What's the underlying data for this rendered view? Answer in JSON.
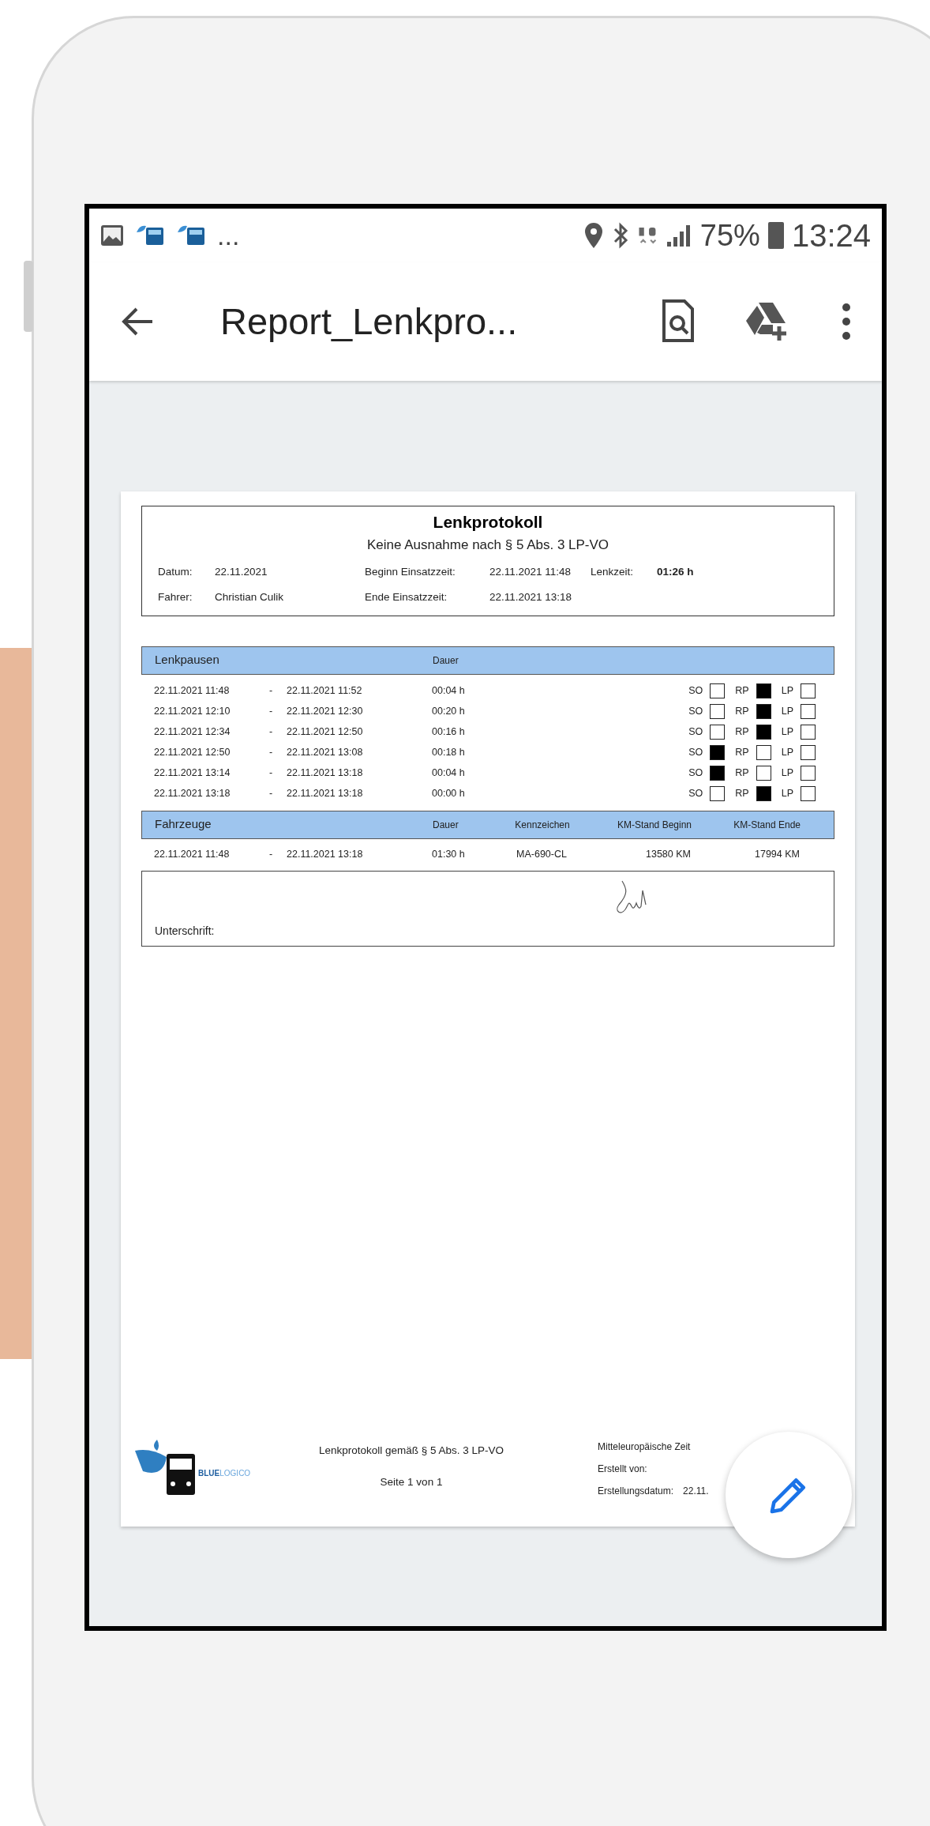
{
  "status_bar": {
    "more": "...",
    "battery": "75%",
    "time": "13:24"
  },
  "app_bar": {
    "title": "Report_Lenkpro..."
  },
  "document": {
    "title": "Lenkprotokoll",
    "subtitle": "Keine Ausnahme nach § 5 Abs. 3 LP-VO",
    "info": [
      {
        "label": "Datum:",
        "value": "22.11.2021"
      },
      {
        "label": "Beginn Einsatzzeit:",
        "value": "22.11.2021 11:48"
      },
      {
        "label": "Lenkzeit:",
        "value": "01:26 h"
      },
      {
        "label": "Fahrer:",
        "value": "Christian Culik"
      },
      {
        "label": "Ende Einsatzzeit:",
        "value": "22.11.2021 13:18"
      }
    ],
    "breaks": {
      "title": "Lenkpausen",
      "duration_heading": "Dauer",
      "rows": [
        {
          "start": "22.11.2021 11:48",
          "dash": "-",
          "end": "22.11.2021 11:52",
          "duration": "00:04 h",
          "flags": [
            {
              "label": "SO",
              "checked": false
            },
            {
              "label": "RP",
              "checked": true
            },
            {
              "label": "LP",
              "checked": false
            }
          ]
        },
        {
          "start": "22.11.2021 12:10",
          "dash": "-",
          "end": "22.11.2021 12:30",
          "duration": "00:20 h",
          "flags": [
            {
              "label": "SO",
              "checked": false
            },
            {
              "label": "RP",
              "checked": true
            },
            {
              "label": "LP",
              "checked": false
            }
          ]
        },
        {
          "start": "22.11.2021 12:34",
          "dash": "-",
          "end": "22.11.2021 12:50",
          "duration": "00:16 h",
          "flags": [
            {
              "label": "SO",
              "checked": false
            },
            {
              "label": "RP",
              "checked": true
            },
            {
              "label": "LP",
              "checked": false
            }
          ]
        },
        {
          "start": "22.11.2021 12:50",
          "dash": "-",
          "end": "22.11.2021 13:08",
          "duration": "00:18 h",
          "flags": [
            {
              "label": "SO",
              "checked": true
            },
            {
              "label": "RP",
              "checked": false
            },
            {
              "label": "LP",
              "checked": false
            }
          ]
        },
        {
          "start": "22.11.2021 13:14",
          "dash": "-",
          "end": "22.11.2021 13:18",
          "duration": "00:04 h",
          "flags": [
            {
              "label": "SO",
              "checked": true
            },
            {
              "label": "RP",
              "checked": false
            },
            {
              "label": "LP",
              "checked": false
            }
          ]
        },
        {
          "start": "22.11.2021 13:18",
          "dash": "-",
          "end": "22.11.2021 13:18",
          "duration": "00:00 h",
          "flags": [
            {
              "label": "SO",
              "checked": false
            },
            {
              "label": "RP",
              "checked": true
            },
            {
              "label": "LP",
              "checked": false
            }
          ]
        }
      ]
    },
    "vehicles": {
      "title": "Fahrzeuge",
      "columns": [
        "Dauer",
        "Kennzeichen",
        "KM-Stand Beginn",
        "KM-Stand Ende"
      ],
      "rows": [
        {
          "start": "22.11.2021 11:48",
          "dash": "-",
          "end": "22.11.2021 13:18",
          "cells": [
            "01:30 h",
            "MA-690-CL",
            "13580 KM",
            "17994 KM"
          ]
        }
      ]
    },
    "signature": {
      "label": "Unterschrift:"
    },
    "footer": {
      "logo_bold": "BLUE",
      "logo_light": "LOGICO",
      "center": [
        "Lenkprotokoll gemäß § 5 Abs. 3 LP-VO",
        "Seite 1 von 1"
      ],
      "right": [
        {
          "label": "Mitteleuropäische Zeit"
        },
        {
          "label": "Erstellt von:"
        },
        {
          "label": "Erstellungsdatum:",
          "value": "22.11."
        }
      ]
    }
  }
}
